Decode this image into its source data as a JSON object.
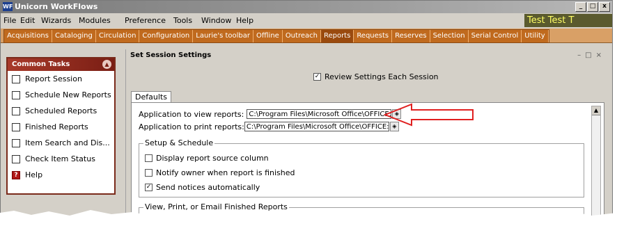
{
  "window": {
    "title": "Unicorn WorkFlows",
    "app_icon": "WF",
    "controls": [
      "_",
      "□",
      "x"
    ]
  },
  "menubar": {
    "items": [
      "File",
      "Edit",
      "Wizards",
      "Modules",
      "Preference",
      "Tools",
      "Window",
      "Help"
    ],
    "user_name": "Test Test T"
  },
  "tabs": {
    "items": [
      "Acquisitions",
      "Cataloging",
      "Circulation",
      "Configuration",
      "Laurie's toolbar",
      "Offline",
      "Outreach",
      "Reports",
      "Requests",
      "Reserves",
      "Selection",
      "Serial Control",
      "Utility"
    ],
    "active": "Reports"
  },
  "tasks": {
    "header": "Common Tasks",
    "items": [
      {
        "label": "Report Session"
      },
      {
        "label": "Schedule New Reports"
      },
      {
        "label": "Scheduled Reports"
      },
      {
        "label": "Finished Reports"
      },
      {
        "label": "Item Search and Dis..."
      },
      {
        "label": "Check Item Status"
      },
      {
        "label": "Help"
      }
    ]
  },
  "panel": {
    "title": "Set Session Settings",
    "review_label": "Review Settings Each Session",
    "tab_label": "Defaults",
    "view_label": "Application to view reports:",
    "view_value": "C:\\Program Files\\Microsoft Office\\OFFICE:",
    "print_label": "Application to print reports:",
    "print_value": "C:\\Program Files\\Microsoft Office\\OFFICE:",
    "setup_group": "Setup & Schedule",
    "options": [
      {
        "label": "Display report source column",
        "checked": false
      },
      {
        "label": "Notify owner when report is finished",
        "checked": false
      },
      {
        "label": "Send notices automatically",
        "checked": true
      }
    ],
    "view_group": "View, Print, or Email Finished Reports"
  },
  "colors": {
    "accent_tab": "#c06a1e",
    "task_header": "#a83a2a",
    "annotation_arrow": "#e02020"
  }
}
